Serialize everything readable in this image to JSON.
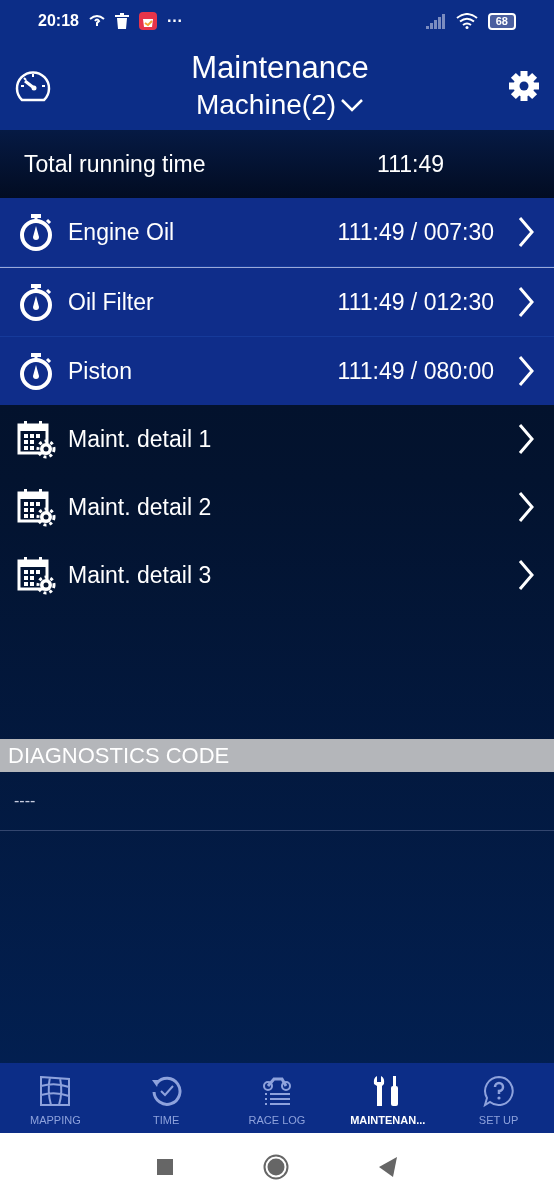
{
  "status_bar": {
    "time": "20:18",
    "more": "···",
    "battery": "68"
  },
  "header": {
    "title": "Maintenance",
    "machine": "Machine(2)"
  },
  "total": {
    "label": "Total running time",
    "value": "111:49"
  },
  "timers": [
    {
      "name": "Engine Oil",
      "reading": "111:49 / 007:30"
    },
    {
      "name": "Oil Filter",
      "reading": "111:49 / 012:30"
    },
    {
      "name": "Piston",
      "reading": "111:49 / 080:00"
    }
  ],
  "details": [
    {
      "name": "Maint. detail 1"
    },
    {
      "name": "Maint. detail 2"
    },
    {
      "name": "Maint. detail 3"
    }
  ],
  "diagnostics": {
    "title": "DIAGNOSTICS CODE",
    "code": "----"
  },
  "tabs": [
    {
      "kind": "mapping",
      "label": "MAPPING",
      "selected": false
    },
    {
      "kind": "time",
      "label": "TIME",
      "selected": false
    },
    {
      "kind": "racelog",
      "label": "RACE LOG",
      "selected": false
    },
    {
      "kind": "maintenance",
      "label": "MAINTENAN...",
      "selected": true
    },
    {
      "kind": "setup",
      "label": "SET UP",
      "selected": false
    }
  ]
}
